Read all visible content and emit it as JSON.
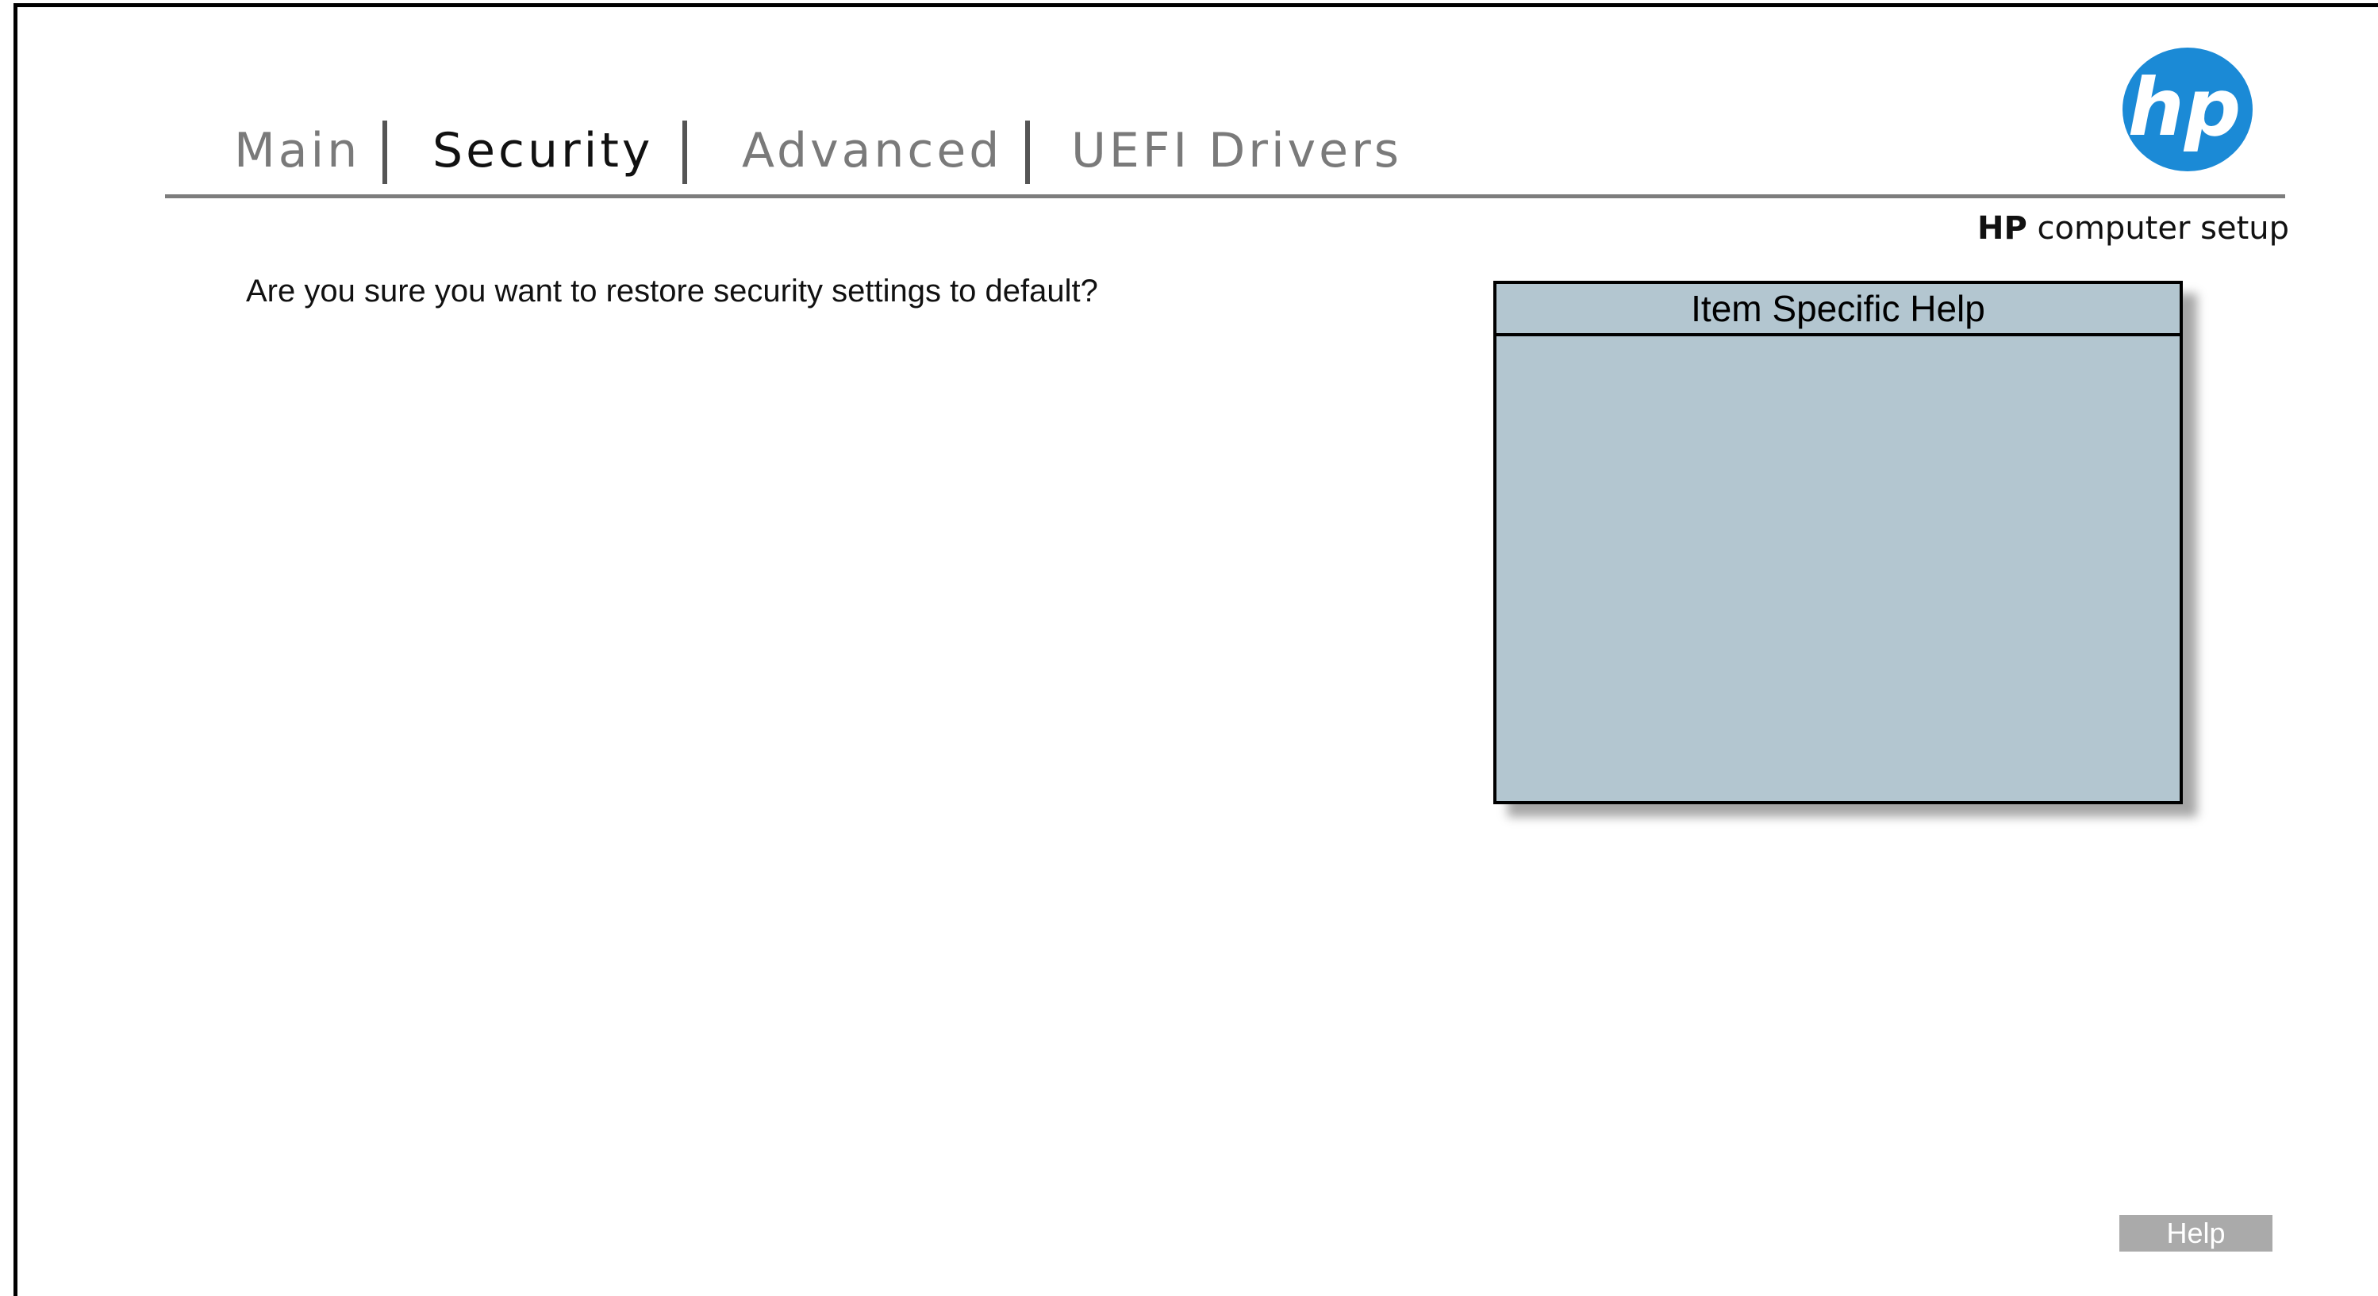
{
  "tabs": [
    {
      "label": "Main",
      "active": false
    },
    {
      "label": "Security",
      "active": true
    },
    {
      "label": "Advanced",
      "active": false
    },
    {
      "label": "UEFI Drivers",
      "active": false
    }
  ],
  "brand": {
    "logo_text": "hp",
    "bold": "HP",
    "rest": " computer setup"
  },
  "main": {
    "prompt": "Are you sure you want to restore security settings to default?"
  },
  "help_panel": {
    "title": "Item Specific Help",
    "body": ""
  },
  "footer": {
    "help_button": "Help"
  },
  "colors": {
    "active_tab": "#111111",
    "inactive_tab": "#7a7a7a",
    "help_panel_bg": "#b3c6d0",
    "logo_blue": "#1b8ad6",
    "help_button_bg": "#aaaaaa"
  }
}
